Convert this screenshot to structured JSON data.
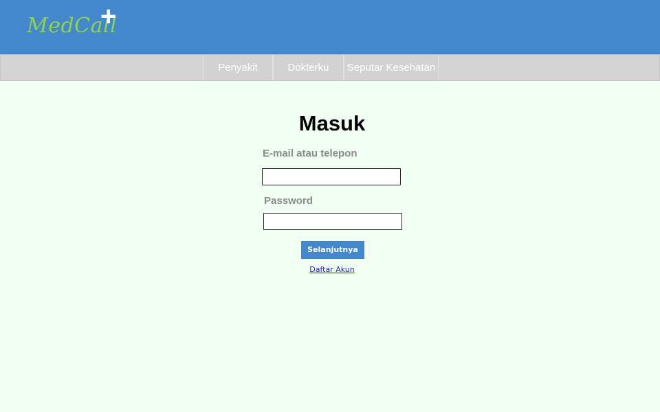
{
  "header": {
    "logo_text": "MedCall",
    "logo_plus": "+",
    "bg_color": "#4387cd"
  },
  "nav": {
    "items": [
      {
        "label": "Penyakit"
      },
      {
        "label": "Dokterku"
      },
      {
        "label": "Seputar Kesehatan"
      }
    ]
  },
  "login": {
    "title": "Masuk",
    "email_label": "E-mail atau telepon",
    "email_value": "",
    "password_label": "Password",
    "password_value": "",
    "submit_label": "Selanjutnya",
    "register_link": "Daftar Akun"
  }
}
